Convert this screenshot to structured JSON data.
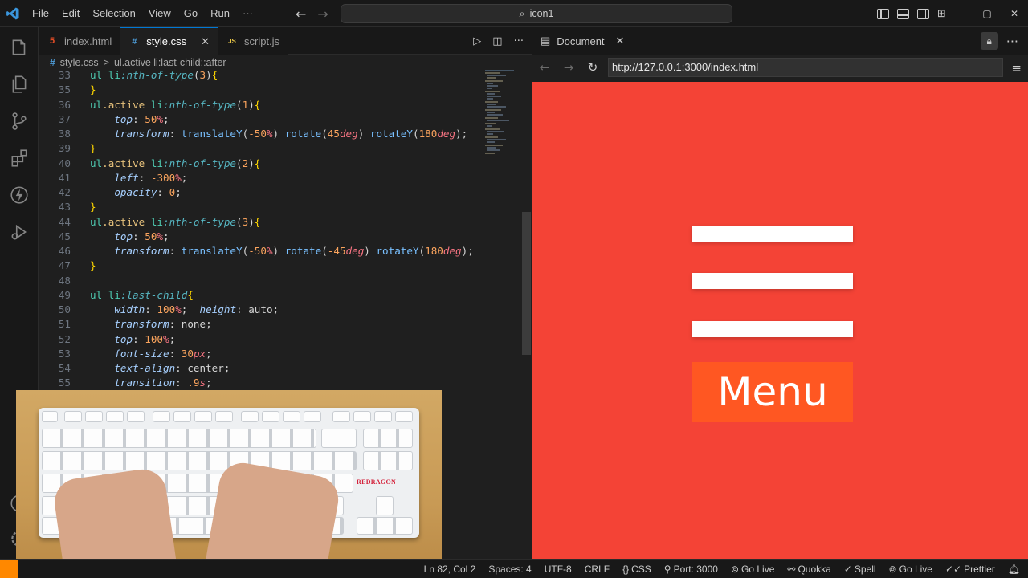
{
  "titlebar": {
    "menu": [
      "File",
      "Edit",
      "Selection",
      "View",
      "Go",
      "Run",
      "···"
    ],
    "search_text": "icon1",
    "search_icon": "search-icon",
    "window_controls": [
      "—",
      "▢",
      "✕"
    ]
  },
  "activity_bar": {
    "icons": [
      "explorer-icon",
      "search-icon",
      "source-control-icon",
      "extensions-icon",
      "thunder-client-icon",
      "run-debug-icon",
      "account-icon",
      "settings-gear-icon"
    ]
  },
  "editor": {
    "tabs": [
      {
        "label": "index.html",
        "icon": "html-file-icon",
        "badge": "5",
        "active": false
      },
      {
        "label": "style.css",
        "icon": "css-file-icon",
        "badge": "#",
        "active": true,
        "close": "✕"
      },
      {
        "label": "script.js",
        "icon": "js-file-icon",
        "badge": "JS",
        "active": false
      }
    ],
    "breadcrumb": {
      "file": "style.css",
      "symbol": "ul.active li:last-child::after",
      "separator": ">"
    },
    "line_numbers": [
      "33",
      "35",
      "36",
      "37",
      "38",
      "39",
      "40",
      "41",
      "42",
      "43",
      "44",
      "45",
      "46",
      "47",
      "48",
      "49",
      "50",
      "51",
      "52",
      "53",
      "54",
      "55"
    ]
  },
  "browser": {
    "tab_label": "Document",
    "tab_close": "✕",
    "url": "http://127.0.0.1:3000/index.html",
    "page": {
      "menu_label": "Menu",
      "background": "#f44336",
      "menu_bg": "#ff5722"
    }
  },
  "overlay": {
    "keyboard_brand": "REDRAGON"
  },
  "statusbar": {
    "position": "Ln 82, Col 2",
    "spaces": "Spaces: 4",
    "encoding": "UTF-8",
    "eol": "CRLF",
    "language": "CSS",
    "port": "Port: 3000",
    "go_live_1": "Go Live",
    "quokka": "Quokka",
    "spell": "Spell",
    "go_live_2": "Go Live",
    "prettier": "Prettier",
    "remote_color": "#ff8800"
  }
}
